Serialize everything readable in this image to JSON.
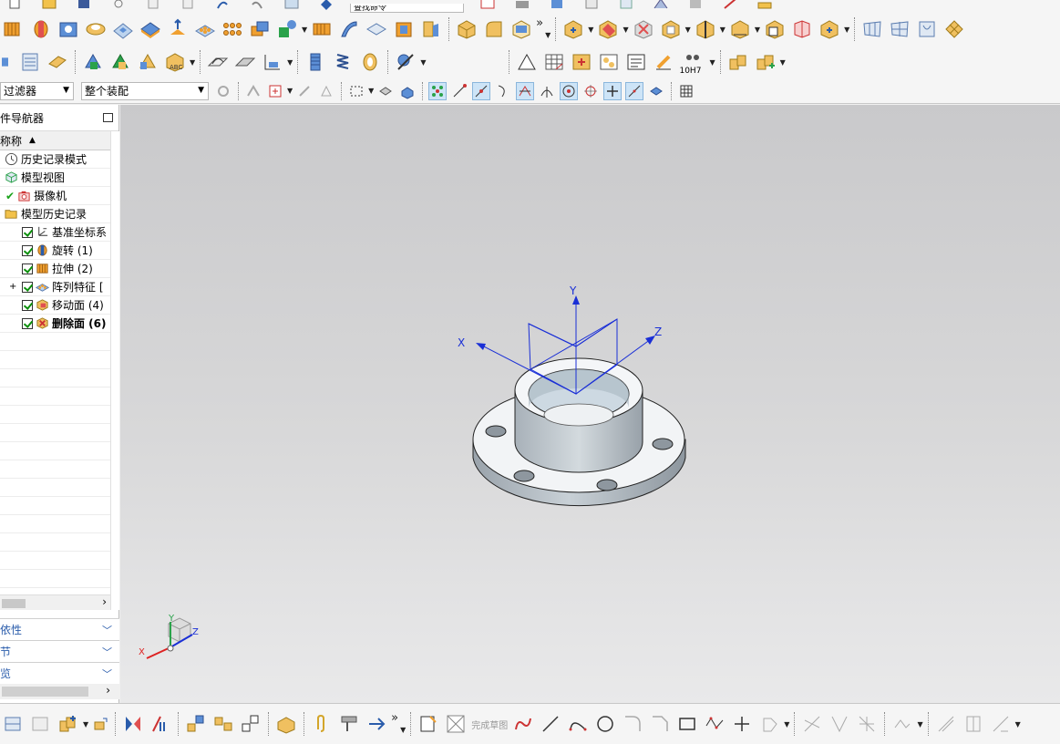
{
  "toolbar": {
    "search_placeholder": "查找命令",
    "selection_filter": "过滤器",
    "assembly_scope": "整个装配",
    "finish_sketch": "完成草图",
    "fit_tolerance": "10H7",
    "overflow": "»"
  },
  "navigator": {
    "title": "件导航器",
    "column_name": "称称",
    "sort_indicator": "▲",
    "items": [
      {
        "label": "历史记录模式",
        "icon": "clock-icon"
      },
      {
        "label": "模型视图",
        "icon": "views-icon"
      },
      {
        "label": "摄像机",
        "icon": "camera-icon"
      },
      {
        "label": "模型历史记录",
        "icon": "folder-icon"
      },
      {
        "label": "基准坐标系",
        "icon": "datum-csys-icon"
      },
      {
        "label": "旋转 (1)",
        "icon": "revolve-icon"
      },
      {
        "label": "拉伸 (2)",
        "icon": "extrude-icon"
      },
      {
        "label": "阵列特征 [",
        "icon": "pattern-icon"
      },
      {
        "label": "移动面 (4)",
        "icon": "move-face-icon"
      },
      {
        "label": "删除面 (6)",
        "icon": "delete-face-icon"
      }
    ],
    "panels": [
      {
        "label": "相依性"
      },
      {
        "label": "细节"
      },
      {
        "label": "预览"
      }
    ],
    "expand_symbol": "+"
  },
  "viewport": {
    "axis_x": "X",
    "axis_y": "Y",
    "axis_z": "Z"
  },
  "colors": {
    "accent": "#2a5cab",
    "viewport_top": "#c9c9cb",
    "viewport_bottom": "#e9e9ea",
    "csys_blue": "#1a2fd6",
    "part_fill": "#dfe5ea"
  }
}
